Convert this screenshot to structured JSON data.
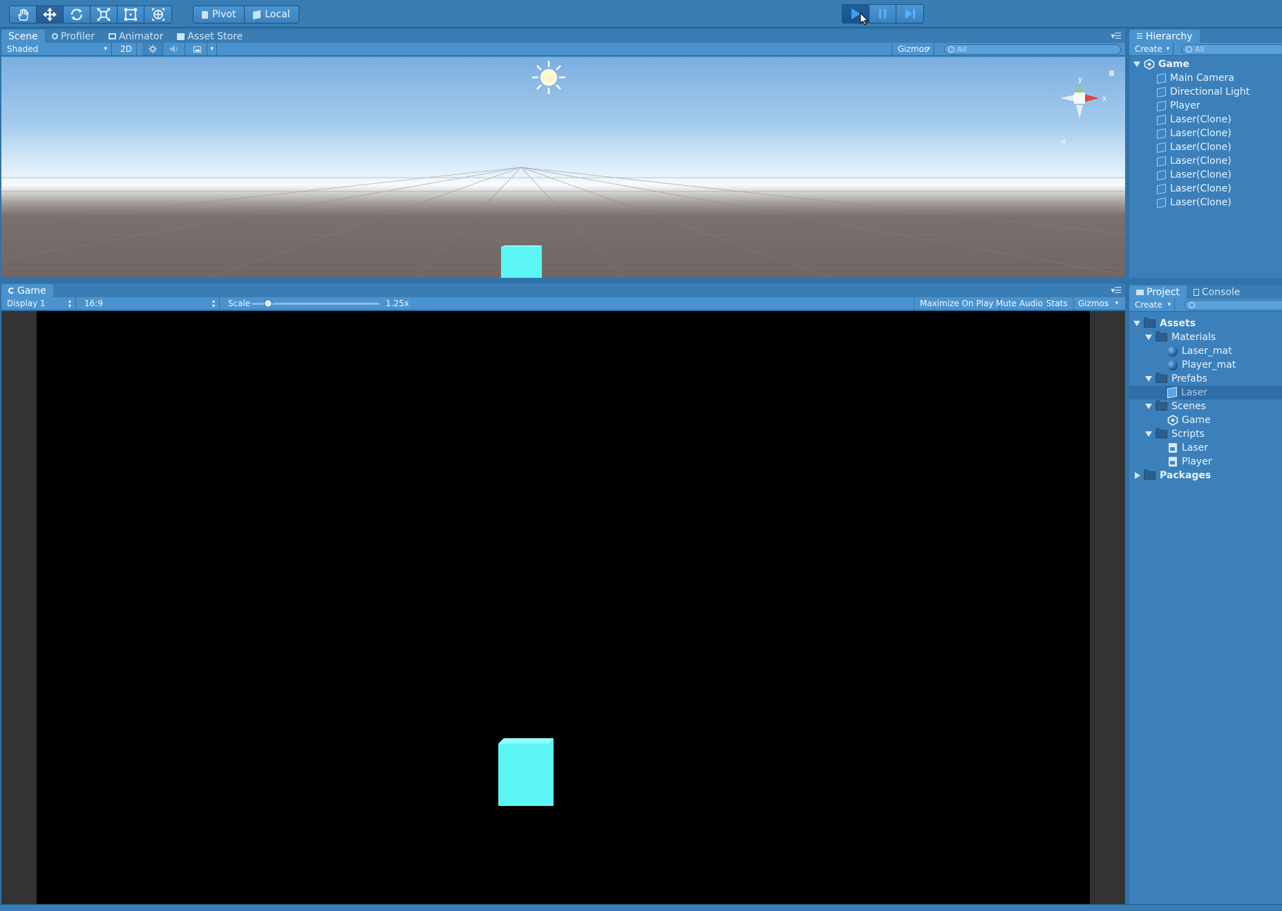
{
  "toolbar": {
    "pivot_label": "Pivot",
    "local_label": "Local"
  },
  "scene_panel": {
    "tabs": [
      "Scene",
      "Profiler",
      "Animator",
      "Asset Store"
    ],
    "shading_mode": "Shaded",
    "mode_2d_label": "2D",
    "gizmos_label": "Gizmos",
    "search_placeholder": "All",
    "gizmo_axis_y": "y",
    "gizmo_axis_x": "x"
  },
  "game_panel": {
    "tab_label": "Game",
    "display_label": "Display 1",
    "aspect_label": "16:9",
    "scale_label": "Scale",
    "scale_value": "1.25x",
    "scale_slider_fraction": 0.13,
    "maximize_label": "Maximize On Play",
    "mute_label": "Mute Audio",
    "stats_label": "Stats",
    "gizmos_label": "Gizmos"
  },
  "hierarchy": {
    "tab_label": "Hierarchy",
    "create_label": "Create",
    "search_placeholder": "All",
    "scene_name": "Game",
    "items": [
      "Main Camera",
      "Directional Light",
      "Player",
      "Laser(Clone)",
      "Laser(Clone)",
      "Laser(Clone)",
      "Laser(Clone)",
      "Laser(Clone)",
      "Laser(Clone)",
      "Laser(Clone)"
    ]
  },
  "project": {
    "tabs": [
      "Project",
      "Console"
    ],
    "create_label": "Create",
    "assets_label": "Assets",
    "materials_label": "Materials",
    "materials": [
      "Laser_mat",
      "Player_mat"
    ],
    "prefabs_label": "Prefabs",
    "prefabs": [
      "Laser"
    ],
    "scenes_label": "Scenes",
    "scenes": [
      "Game"
    ],
    "scripts_label": "Scripts",
    "scripts": [
      "Laser",
      "Player"
    ],
    "packages_label": "Packages"
  },
  "colors": {
    "editor_bg": "#2f73a8",
    "toolbar": "#3a7db4",
    "panel_header": "#4b93cf",
    "selection": "#2e6da6",
    "cube": "#5cf5f5"
  },
  "icons": {
    "hand_tool": "hand-icon",
    "move_tool": "move-icon",
    "rotate_tool": "rotate-icon",
    "scale_tool": "scale-icon",
    "rect_tool": "rect-icon",
    "transform_tool": "transform-icon",
    "play": "play-icon",
    "pause": "pause-icon",
    "step": "step-icon"
  }
}
